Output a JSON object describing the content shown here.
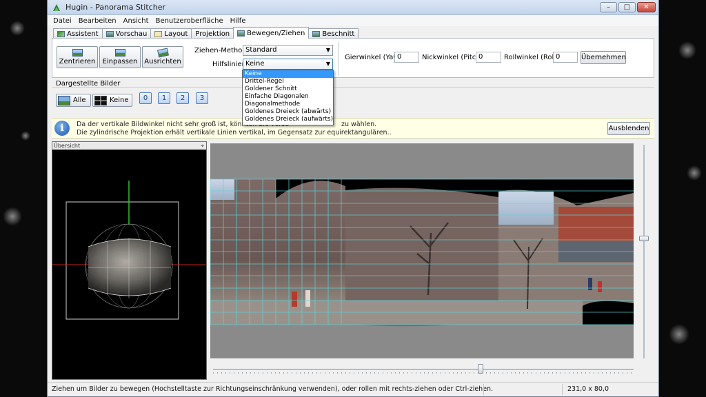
{
  "window": {
    "title": "Hugin - Panorama Stitcher",
    "controls": [
      "–",
      "□",
      "✕"
    ]
  },
  "menu": [
    "Datei",
    "Bearbeiten",
    "Ansicht",
    "Benutzeroberfläche",
    "Hilfe"
  ],
  "tabs": [
    {
      "label": "Assistent",
      "icon": "wizard-icon"
    },
    {
      "label": "Vorschau",
      "icon": "preview-icon"
    },
    {
      "label": "Layout",
      "icon": "layout-icon"
    },
    {
      "label": "Projektion",
      "icon": ""
    },
    {
      "label": "Bewegen/Ziehen",
      "icon": "move-icon",
      "active": true
    },
    {
      "label": "Beschnitt",
      "icon": "crop-icon"
    }
  ],
  "toolbar": {
    "center_label": "Zentrieren",
    "fit_label": "Einpassen",
    "straighten_label": "Ausrichten",
    "drag_method_label": "Ziehen-Methode:",
    "drag_method_value": "Standard",
    "guides_label": "Hilfslinien:",
    "guides_value": "Keine",
    "yaw_label": "Gierwinkel (Yaw):",
    "yaw_value": "0",
    "pitch_label": "Nickwinkel (Pitch):",
    "pitch_value": "0",
    "roll_label": "Rollwinkel (Roll):",
    "roll_value": "0",
    "apply_label": "Übernehmen"
  },
  "guides_options": [
    "Keine",
    "Drittel-Regel",
    "Goldener Schnitt",
    "Einfache Diagonalen",
    "Diagonalmethode",
    "Goldenes Dreieck (abwärts)",
    "Goldenes Dreieck (aufwärts)"
  ],
  "images": {
    "section_label": "Dargestellte Bilder",
    "all_label": "Alle",
    "none_label": "Keine",
    "numbers": [
      "0",
      "1",
      "2",
      "3"
    ]
  },
  "info": {
    "line1_start": "Da der vertikale Bildwinkel nicht sehr groß ist, könnten Sie versu",
    "line1_end": "zu wählen.",
    "line2": "Die zylindrische Projektion erhält vertikale Linien vertikal, im Gegensatz zur equirektangulären..",
    "hide_label": "Ausblenden"
  },
  "overview": {
    "title": "Übersicht",
    "pin": "⌖"
  },
  "status": {
    "text": "Ziehen um Bilder zu bewegen (Hochstelltaste zur Richtungseinschränkung verwenden), oder rollen mit rechts-ziehen oder Ctrl-ziehen.",
    "coords": "231,0 x 80,0"
  },
  "colors": {
    "accent": "#3399ff",
    "grid": "#58d6dc",
    "info_bg": "#ffffe6",
    "preview_bg": "#8a8a8a"
  }
}
